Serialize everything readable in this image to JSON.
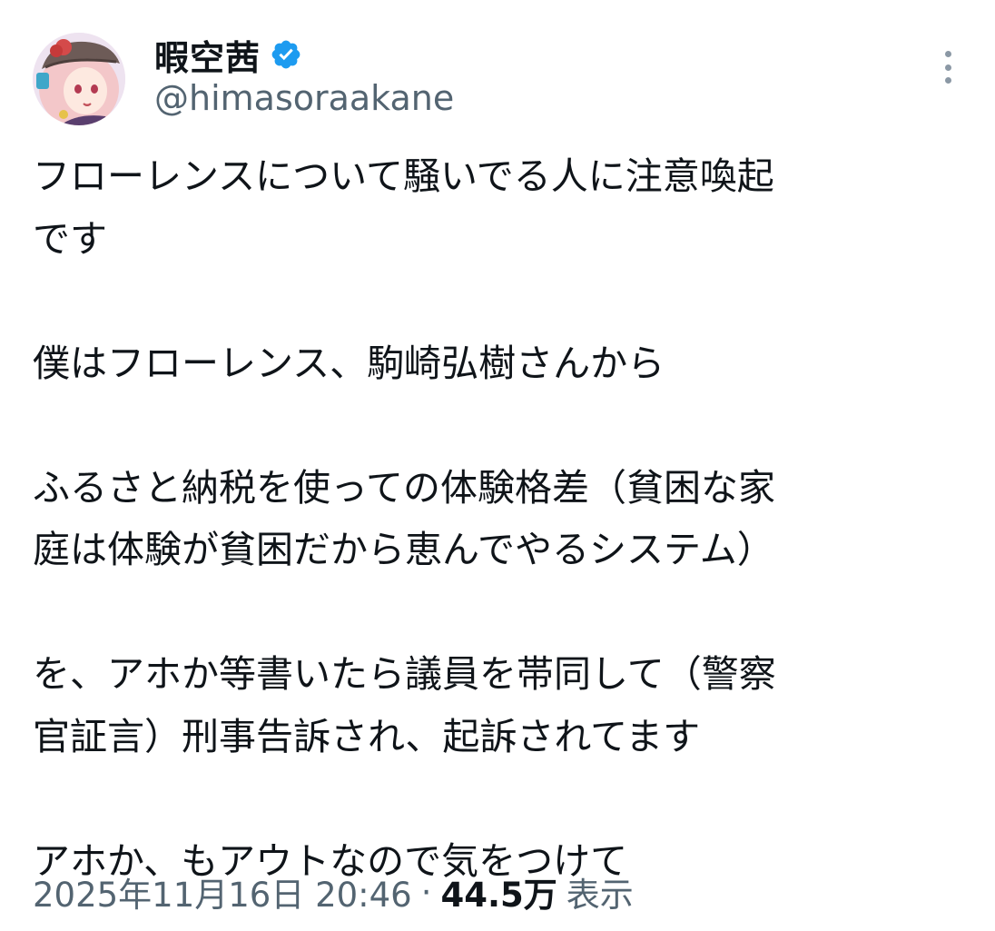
{
  "author": {
    "display_name": "暇空茜",
    "handle": "@himasoraakane",
    "verified": true
  },
  "tweet": {
    "lines": [
      "フローレンスについて騒いでる人に注意喚起",
      "です",
      "",
      "僕はフローレンス、駒崎弘樹さんから",
      "",
      "ふるさと納税を使っての体験格差（貧困な家",
      "庭は体験が貧困だから恵んでやるシステム）",
      "",
      "を、アホか等書いたら議員を帯同して（警察",
      "官証言）刑事告訴され、起訴されてます",
      "",
      "アホか、もアウトなので気をつけて"
    ],
    "timestamp": "2025年11月16日 20:46",
    "separator": "·",
    "views_count": "44.5万",
    "views_label": "表示"
  },
  "icons": {
    "verified": "verified-badge-icon",
    "more": "more-vertical-icon"
  },
  "colors": {
    "text_primary": "#0f1419",
    "text_secondary": "#536471",
    "verified_blue": "#1d9bf0",
    "background": "#ffffff"
  }
}
